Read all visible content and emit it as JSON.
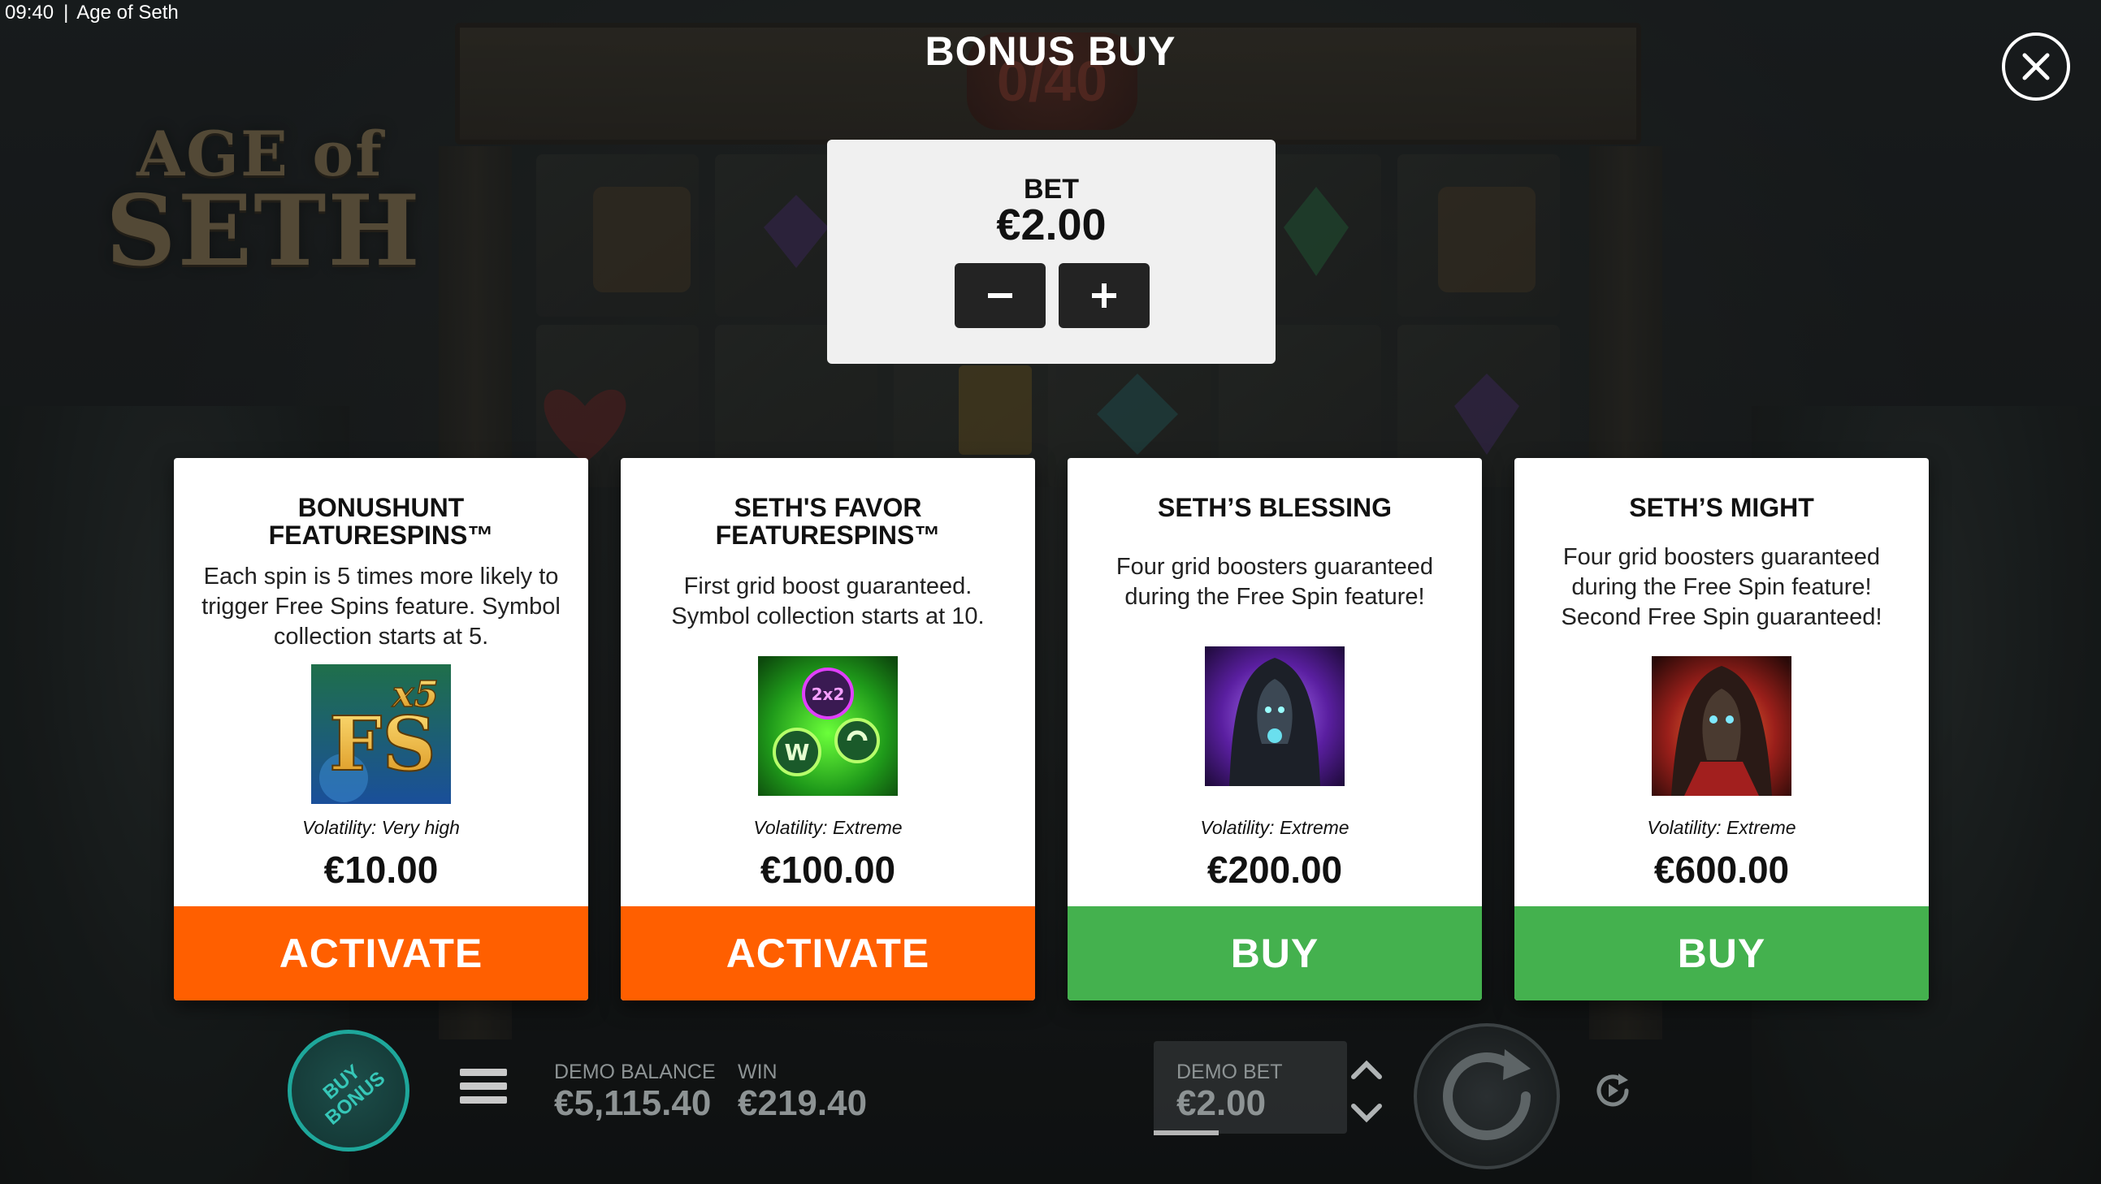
{
  "status_bar": {
    "time": "09:40",
    "separator": "|",
    "app_title": "Age of Seth"
  },
  "background": {
    "logo_line1": "AGE of",
    "logo_line2": "SETH",
    "counter": "0/40"
  },
  "dialog": {
    "title": "BONUS BUY",
    "close_icon": "close-icon"
  },
  "bet": {
    "label": "BET",
    "value": "€2.00",
    "minus_icon": "minus-icon",
    "plus_icon": "plus-icon"
  },
  "cards": [
    {
      "title": "BONUSHUNT\nFEATURESPINS™",
      "description": "Each spin is 5 times more likely to\ntrigger Free Spins feature. Symbol\ncollection starts at 5.",
      "image_icon": "fs-x5-icon",
      "image_text_main": "FS",
      "image_text_mult": "x5",
      "volatility": "Volatility: Very high",
      "price": "€10.00",
      "action": "ACTIVATE",
      "action_color": "#ff5f00"
    },
    {
      "title": "SETH'S FAVOR\nFEATURESPINS™",
      "description": "First grid boost guaranteed.\nSymbol collection starts at 10.",
      "image_icon": "grid-boost-icon",
      "image_text_main": "2x2",
      "image_text_mult": "W",
      "volatility": "Volatility: Extreme",
      "price": "€100.00",
      "action": "ACTIVATE",
      "action_color": "#ff5f00"
    },
    {
      "title": "SETH’S BLESSING",
      "description": "Four grid boosters guaranteed\nduring the Free Spin feature!",
      "image_icon": "hooded-seth-purple-icon",
      "volatility": "Volatility: Extreme",
      "price": "€200.00",
      "action": "BUY",
      "action_color": "#44b14e"
    },
    {
      "title": "SETH’S MIGHT",
      "description": "Four grid boosters guaranteed\nduring the Free Spin feature!\nSecond Free Spin guaranteed!",
      "image_icon": "hooded-seth-red-icon",
      "volatility": "Volatility: Extreme",
      "price": "€600.00",
      "action": "BUY",
      "action_color": "#44b14e"
    }
  ],
  "bottom_bar": {
    "buy_bonus_label": "BUY\nBONUS",
    "menu_icon": "hamburger-menu-icon",
    "balance_label": "DEMO BALANCE",
    "balance_value": "€5,115.40",
    "win_label": "WIN",
    "win_value": "€219.40",
    "bet_label": "DEMO BET",
    "bet_value": "€2.00",
    "spin_icon": "spin-icon",
    "autoplay_icon": "autoplay-icon"
  }
}
